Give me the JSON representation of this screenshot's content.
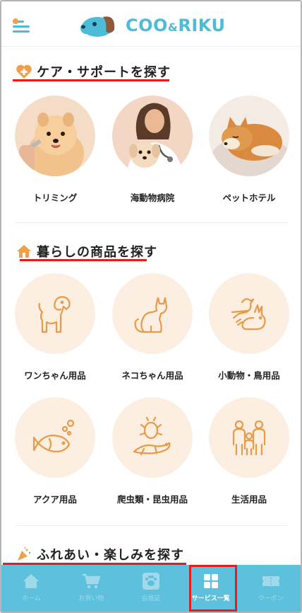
{
  "header": {
    "logo_text": "COO",
    "logo_amp": "&",
    "logo_text2": "RIKU"
  },
  "sections": [
    {
      "title": "ケア・サポートを探す",
      "icon": "heart-plus-icon",
      "items": [
        {
          "label": "トリミング",
          "image": "pomeranian-photo"
        },
        {
          "label": "海動物病院",
          "image": "veterinarian-photo"
        },
        {
          "label": "ペットホテル",
          "image": "sleeping-shiba-photo"
        }
      ]
    },
    {
      "title": "暮らしの商品を探す",
      "icon": "house-icon",
      "items": [
        {
          "label": "ワンちゃん用品",
          "icon": "dog-icon"
        },
        {
          "label": "ネコちゃん用品",
          "icon": "cat-icon"
        },
        {
          "label": "小動物・鳥用品",
          "icon": "bird-rabbit-icon"
        },
        {
          "label": "アクア用品",
          "icon": "fish-icon"
        },
        {
          "label": "爬虫類・昆虫用品",
          "icon": "reptile-beetle-icon"
        },
        {
          "label": "生活用品",
          "icon": "family-icon"
        }
      ]
    },
    {
      "title": "ふれあい・楽しみを探す",
      "icon": "party-popper-icon"
    }
  ],
  "bottom_nav": [
    {
      "label": "ホーム",
      "icon": "home-icon"
    },
    {
      "label": "お買い物",
      "icon": "cart-icon"
    },
    {
      "label": "会員証",
      "icon": "paw-card-icon"
    },
    {
      "label": "サービス一覧",
      "icon": "grid-icon",
      "active": true
    },
    {
      "label": "クーポン",
      "icon": "ticket-icon"
    }
  ],
  "colors": {
    "accent": "#4cbcd9",
    "orange": "#f0a04a",
    "highlight": "#e81c1c",
    "nav_bg": "#5dc0dd",
    "circle_bg": "#fdeee2"
  }
}
